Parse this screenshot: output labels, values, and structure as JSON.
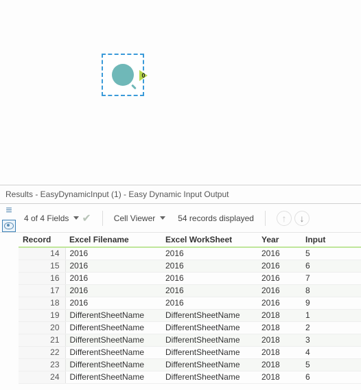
{
  "canvas": {
    "port_label": "0"
  },
  "results_bar": {
    "title": "Results - EasyDynamicInput (1) - Easy Dynamic Input Output"
  },
  "toolbar": {
    "fields_label": "4 of 4 Fields",
    "cell_viewer_label": "Cell Viewer",
    "records_label": "54 records displayed"
  },
  "grid": {
    "headers": {
      "record": "Record",
      "filename": "Excel Filename",
      "worksheet": "Excel WorkSheet",
      "year": "Year",
      "input": "Input"
    },
    "rows": [
      {
        "rec": "14",
        "filename": "2016",
        "worksheet": "2016",
        "year": "2016",
        "input": "5"
      },
      {
        "rec": "15",
        "filename": "2016",
        "worksheet": "2016",
        "year": "2016",
        "input": "6"
      },
      {
        "rec": "16",
        "filename": "2016",
        "worksheet": "2016",
        "year": "2016",
        "input": "7"
      },
      {
        "rec": "17",
        "filename": "2016",
        "worksheet": "2016",
        "year": "2016",
        "input": "8"
      },
      {
        "rec": "18",
        "filename": "2016",
        "worksheet": "2016",
        "year": "2016",
        "input": "9"
      },
      {
        "rec": "19",
        "filename": "DifferentSheetName",
        "worksheet": "DifferentSheetName",
        "year": "2018",
        "input": "1"
      },
      {
        "rec": "20",
        "filename": "DifferentSheetName",
        "worksheet": "DifferentSheetName",
        "year": "2018",
        "input": "2"
      },
      {
        "rec": "21",
        "filename": "DifferentSheetName",
        "worksheet": "DifferentSheetName",
        "year": "2018",
        "input": "3"
      },
      {
        "rec": "22",
        "filename": "DifferentSheetName",
        "worksheet": "DifferentSheetName",
        "year": "2018",
        "input": "4"
      },
      {
        "rec": "23",
        "filename": "DifferentSheetName",
        "worksheet": "DifferentSheetName",
        "year": "2018",
        "input": "5"
      },
      {
        "rec": "24",
        "filename": "DifferentSheetName",
        "worksheet": "DifferentSheetName",
        "year": "2018",
        "input": "6"
      }
    ]
  }
}
